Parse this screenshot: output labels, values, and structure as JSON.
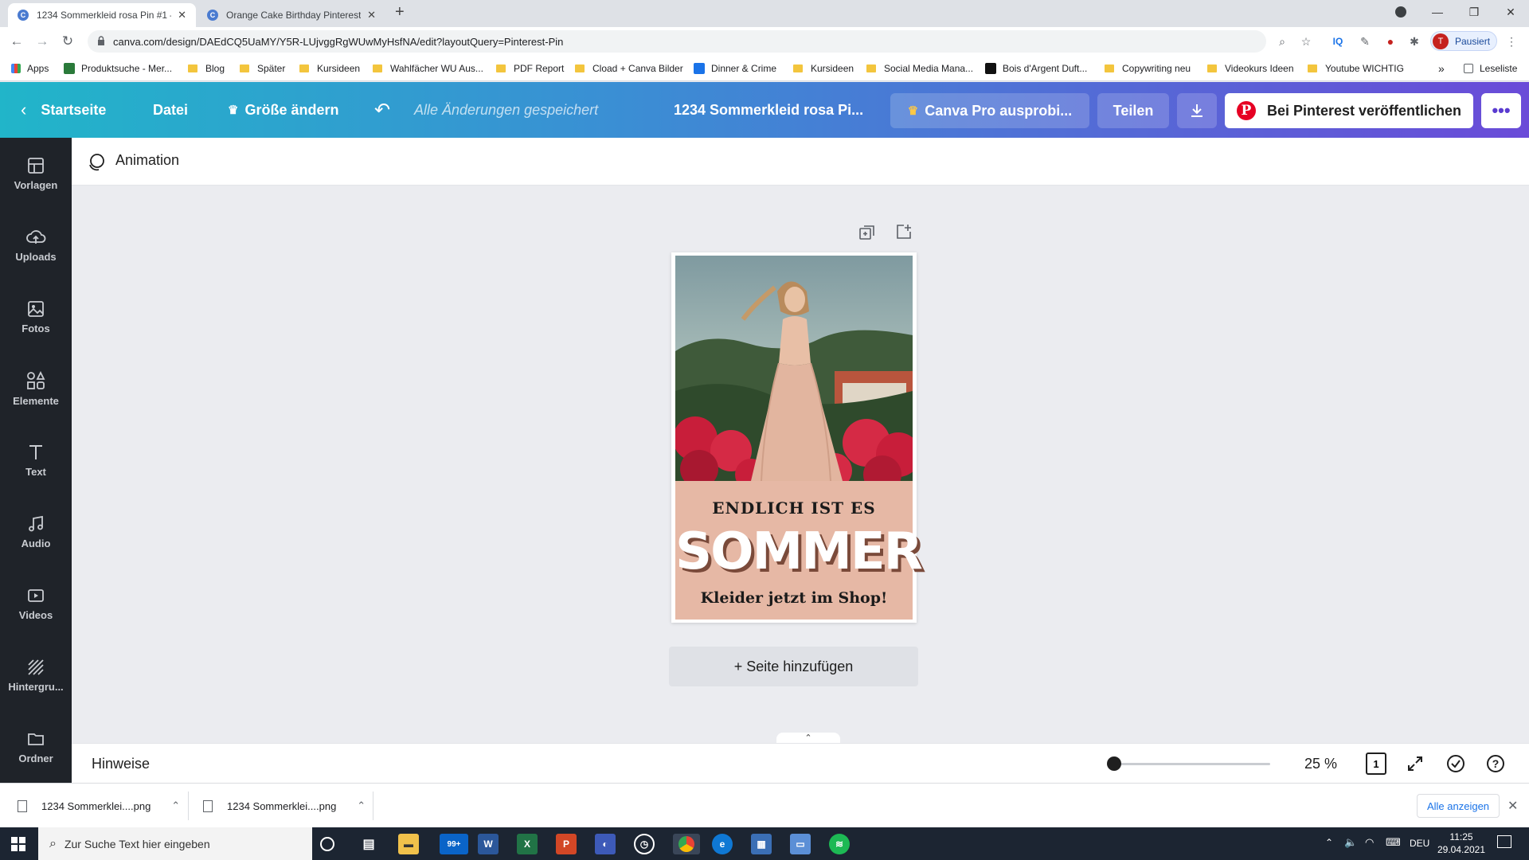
{
  "browser": {
    "tabs": [
      {
        "title": "1234 Sommerkleid rosa Pin #1 – ",
        "active": true
      },
      {
        "title": "Orange Cake Birthday Pinterest C",
        "active": false
      }
    ],
    "url": "canva.com/design/DAEdCQ5UaMY/Y5R-LUjvggRgWUwMyHsfNA/edit?layoutQuery=Pinterest-Pin",
    "profile_label": "Pausiert",
    "profile_initial": "T",
    "bookmarks": [
      "Apps",
      "Produktsuche - Mer...",
      "Blog",
      "Später",
      "Kursideen",
      "Wahlfächer WU Aus...",
      "PDF Report",
      "Cload + Canva Bilder",
      "Dinner & Crime",
      "Kursideen",
      "Social Media Mana...",
      "Bois d'Argent Duft...",
      "Copywriting neu",
      "Videokurs Ideen",
      "Youtube WICHTIG"
    ],
    "reading_list": "Leseliste"
  },
  "header": {
    "home": "Startseite",
    "file": "Datei",
    "resize": "Größe ändern",
    "saved_status": "Alle Änderungen gespeichert",
    "design_title": "1234 Sommerkleid rosa Pi...",
    "try_pro": "Canva Pro ausprobi...",
    "share": "Teilen",
    "publish": "Bei Pinterest veröffentlichen"
  },
  "sidebar": {
    "items": [
      "Vorlagen",
      "Uploads",
      "Fotos",
      "Elemente",
      "Text",
      "Audio",
      "Videos",
      "Hintergru...",
      "Ordner"
    ]
  },
  "toolbar": {
    "animation": "Animation"
  },
  "design": {
    "line1": "ENDLICH IST ES",
    "line2": "SOMMER",
    "line3": "Kleider jetzt im Shop!"
  },
  "canvas": {
    "add_page": "+ Seite hinzufügen"
  },
  "footer": {
    "notes": "Hinweise",
    "zoom": "25 %",
    "page_count": "1"
  },
  "downloads": {
    "files": [
      "1234 Sommerklei....png",
      "1234 Sommerklei....png"
    ],
    "show_all": "Alle anzeigen"
  },
  "taskbar": {
    "search_placeholder": "Zur Suche Text hier eingeben",
    "language": "DEU",
    "time": "11:25",
    "date": "29.04.2021",
    "badge": "99+"
  },
  "colors": {
    "header_start": "#21b5c9",
    "header_end": "#6a4bd8",
    "pinterest_red": "#e60023",
    "sidebar_bg": "#1f2329",
    "design_panel": "#e6b8a5"
  }
}
